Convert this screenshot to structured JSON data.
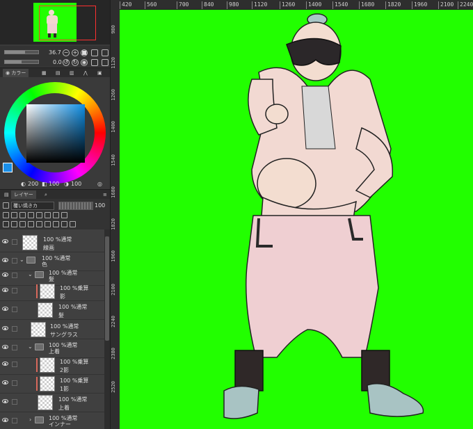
{
  "colors": {
    "canvas_bg": "#22ff00",
    "main_color": "#1a8fe8",
    "sub_color": "#ffffff",
    "clip_marker": "#d8695c",
    "nav_frame": "#ff3030"
  },
  "navigator": {
    "zoom": "36.7",
    "rotation": "0.0"
  },
  "color_panel": {
    "tabs": [
      "カラー"
    ],
    "h_value": "200",
    "s_value": "100",
    "v_value": "100"
  },
  "layer_panel": {
    "tabs": [
      "レイヤー"
    ],
    "blend_mode": "覆い焼きカ",
    "opacity": "100"
  },
  "layers": [
    {
      "mode": "100 %通常",
      "name": "線画",
      "kind": "raster",
      "depth": 0
    },
    {
      "mode": "100 %通常",
      "name": "色",
      "kind": "folder",
      "depth": 0
    },
    {
      "mode": "100 %通常",
      "name": "髪",
      "kind": "folder",
      "depth": 1
    },
    {
      "mode": "100 %乗算",
      "name": "影",
      "kind": "raster",
      "depth": 2,
      "clipped": true
    },
    {
      "mode": "100 %通常",
      "name": "髪",
      "kind": "raster",
      "depth": 2
    },
    {
      "mode": "100 %通常",
      "name": "サングラス",
      "kind": "raster",
      "depth": 1
    },
    {
      "mode": "100 %通常",
      "name": "上着",
      "kind": "folder",
      "depth": 1
    },
    {
      "mode": "100 %乗算",
      "name": "2影",
      "kind": "raster",
      "depth": 2,
      "clipped": true
    },
    {
      "mode": "100 %乗算",
      "name": "1影",
      "kind": "raster",
      "depth": 2,
      "clipped": true
    },
    {
      "mode": "100 %通常",
      "name": "上着",
      "kind": "raster",
      "depth": 2
    },
    {
      "mode": "100 %通常",
      "name": "インナー",
      "kind": "folder",
      "depth": 1
    }
  ],
  "rulers": {
    "horizontal": [
      "420",
      "560",
      "700",
      "840",
      "980",
      "1120",
      "1260",
      "1400",
      "1540",
      "1680",
      "1820",
      "1960",
      "2100",
      "2240"
    ],
    "vertical": [
      "980",
      "1120",
      "1260",
      "1400",
      "1540",
      "1680",
      "1820",
      "1960",
      "2100",
      "2240",
      "2380",
      "2520"
    ]
  }
}
